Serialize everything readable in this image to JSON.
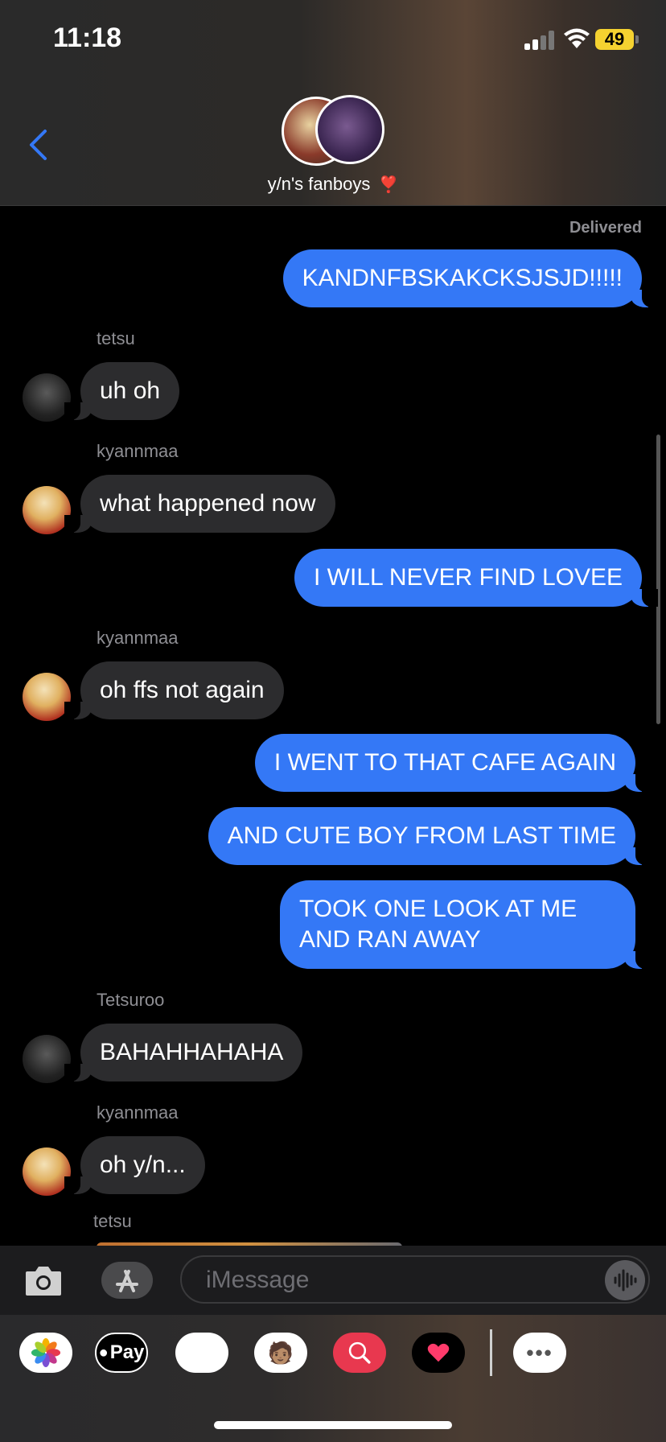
{
  "status_bar": {
    "time": "11:18",
    "battery": "49"
  },
  "header": {
    "group_name": "y/n's fanboys",
    "heart": "❣️"
  },
  "messages": [
    {
      "type": "status",
      "text": "Delivered"
    },
    {
      "type": "out",
      "text": "KANDNFBSKAKCKSJSJD!!!!!"
    },
    {
      "type": "in",
      "sender": "tetsu",
      "text": "uh oh"
    },
    {
      "type": "in",
      "sender": "kyannmaa",
      "text": "what happened now"
    },
    {
      "type": "out",
      "text": "I WILL NEVER FIND LOVEE"
    },
    {
      "type": "in",
      "sender": "kyannmaa",
      "text": "oh ffs not again"
    },
    {
      "type": "out",
      "text": "I WENT TO THAT CAFE AGAIN"
    },
    {
      "type": "out",
      "text": "AND CUTE BOY FROM LAST TIME"
    },
    {
      "type": "out",
      "text": "TOOK ONE LOOK AT ME AND RAN AWAY"
    },
    {
      "type": "in",
      "sender": "Tetsuroo",
      "text": "BAHAHHAHAHA"
    },
    {
      "type": "in",
      "sender": "kyannmaa",
      "text": "oh y/n..."
    },
    {
      "type": "in",
      "sender": "tetsu",
      "text": ""
    }
  ],
  "input": {
    "placeholder": "iMessage"
  },
  "app_drawer": {
    "apps": [
      {
        "name": "photos-app-icon",
        "label": ""
      },
      {
        "name": "apple-pay-app-icon",
        "label": "Pay"
      },
      {
        "name": "animoji-app-icon",
        "label": "🐵"
      },
      {
        "name": "memoji-app-icon",
        "label": "🧑🏽"
      },
      {
        "name": "images-search-app-icon",
        "label": ""
      },
      {
        "name": "digital-touch-app-icon",
        "label": ""
      },
      {
        "name": "more-apps-icon",
        "label": "•••"
      }
    ]
  },
  "colors": {
    "outgoing": "#3478f6",
    "incoming": "#2c2c2e",
    "accent": "#3478f6"
  }
}
